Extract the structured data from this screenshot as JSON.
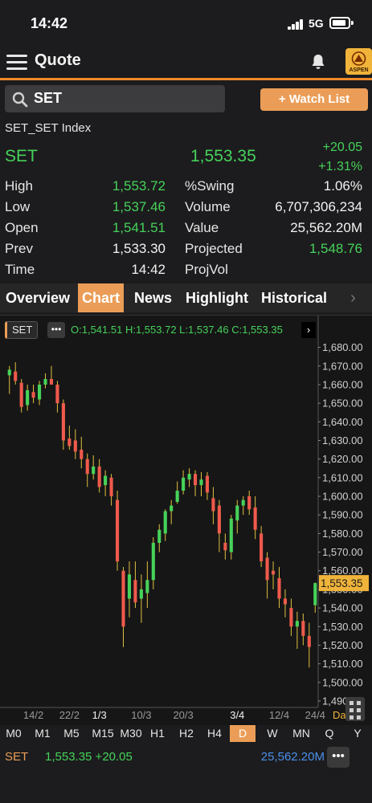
{
  "status_bar": {
    "time": "14:42",
    "network": "5G"
  },
  "header": {
    "title": "Quote",
    "logo_text": "ASPEN"
  },
  "search": {
    "value": "SET"
  },
  "watch_button": "+ Watch List",
  "quote": {
    "index_name": "SET_SET Index",
    "symbol": "SET",
    "last": "1,553.35",
    "change": "+20.05",
    "change_pct": "+1.31%"
  },
  "stats": [
    {
      "label": "High",
      "value": "1,553.72",
      "color": "green",
      "label2": "%Swing",
      "value2": "1.06%",
      "color2": "white"
    },
    {
      "label": "Low",
      "value": "1,537.46",
      "color": "green",
      "label2": "Volume",
      "value2": "6,707,306,234",
      "color2": "white"
    },
    {
      "label": "Open",
      "value": "1,541.51",
      "color": "green",
      "label2": "Value",
      "value2": "25,562.20M",
      "color2": "white"
    },
    {
      "label": "Prev",
      "value": "1,533.30",
      "color": "white",
      "label2": "Projected",
      "value2": "1,548.76",
      "color2": "green"
    },
    {
      "label": "Time",
      "value": "14:42",
      "color": "white",
      "label2": "ProjVol",
      "value2": "",
      "color2": "white"
    }
  ],
  "tabs": [
    "Overview",
    "Chart",
    "News",
    "Highlight",
    "Historical"
  ],
  "active_tab": "Chart",
  "chart_header": {
    "symbol": "SET",
    "ohlc": "O:1,541.51 H:1,553.72 L:1,537.46 C:1,553.35"
  },
  "chart_data": {
    "type": "candlestick",
    "ylim": [
      1490,
      1685
    ],
    "y_ticks": [
      "1,680.00",
      "1,670.00",
      "1,660.00",
      "1,650.00",
      "1,640.00",
      "1,630.00",
      "1,620.00",
      "1,610.00",
      "1,600.00",
      "1,590.00",
      "1,580.00",
      "1,570.00",
      "1,560.00",
      "1,550.00",
      "1,540.00",
      "1,530.00",
      "1,520.00",
      "1,510.00",
      "1,500.00",
      "1,490.00"
    ],
    "y_tick_values": [
      1680,
      1670,
      1660,
      1650,
      1640,
      1630,
      1620,
      1610,
      1600,
      1590,
      1580,
      1570,
      1560,
      1550,
      1540,
      1530,
      1520,
      1510,
      1500,
      1490
    ],
    "last_label": "1,553.35",
    "last_value": 1553.35,
    "x_labels": [
      {
        "text": "14/2",
        "i": 4,
        "color": "#999999"
      },
      {
        "text": "22/2",
        "i": 10,
        "color": "#999999"
      },
      {
        "text": "1/3",
        "i": 15,
        "color": "#f2f2f2"
      },
      {
        "text": "10/3",
        "i": 22,
        "color": "#999999"
      },
      {
        "text": "20/3",
        "i": 29,
        "color": "#999999"
      },
      {
        "text": "3/4",
        "i": 38,
        "color": "#f2f2f2"
      },
      {
        "text": "12/4",
        "i": 45,
        "color": "#999999"
      },
      {
        "text": "24/4",
        "i": 51,
        "color": "#999999"
      }
    ],
    "period_label": "Day",
    "up_color": "#46d25a",
    "down_color": "#ef5a4c",
    "candles": [
      [
        1665,
        1670,
        1655,
        1668
      ],
      [
        1667,
        1672,
        1660,
        1662
      ],
      [
        1661,
        1663,
        1645,
        1648
      ],
      [
        1649,
        1660,
        1646,
        1657
      ],
      [
        1656,
        1660,
        1650,
        1653
      ],
      [
        1652,
        1662,
        1649,
        1660
      ],
      [
        1660,
        1666,
        1658,
        1663
      ],
      [
        1663,
        1670,
        1660,
        1660
      ],
      [
        1660,
        1662,
        1645,
        1650
      ],
      [
        1650,
        1652,
        1625,
        1630
      ],
      [
        1631,
        1638,
        1625,
        1627
      ],
      [
        1630,
        1636,
        1620,
        1624
      ],
      [
        1625,
        1632,
        1615,
        1620
      ],
      [
        1620,
        1623,
        1605,
        1612
      ],
      [
        1612,
        1622,
        1609,
        1616
      ],
      [
        1616,
        1620,
        1602,
        1605
      ],
      [
        1606,
        1614,
        1600,
        1611
      ],
      [
        1610,
        1612,
        1595,
        1600
      ],
      [
        1598,
        1603,
        1560,
        1565
      ],
      [
        1560,
        1562,
        1519,
        1530
      ],
      [
        1545,
        1565,
        1535,
        1558
      ],
      [
        1555,
        1565,
        1540,
        1543
      ],
      [
        1545,
        1558,
        1532,
        1550
      ],
      [
        1548,
        1565,
        1540,
        1555
      ],
      [
        1555,
        1578,
        1550,
        1575
      ],
      [
        1575,
        1585,
        1570,
        1582
      ],
      [
        1580,
        1593,
        1576,
        1592
      ],
      [
        1592,
        1598,
        1585,
        1595
      ],
      [
        1597,
        1608,
        1596,
        1603
      ],
      [
        1603,
        1614,
        1601,
        1610
      ],
      [
        1609,
        1615,
        1605,
        1612
      ],
      [
        1612,
        1614,
        1600,
        1606
      ],
      [
        1606,
        1613,
        1600,
        1609
      ],
      [
        1611,
        1613,
        1598,
        1602
      ],
      [
        1599,
        1605,
        1585,
        1592
      ],
      [
        1595,
        1598,
        1570,
        1580
      ],
      [
        1575,
        1580,
        1566,
        1571
      ],
      [
        1570,
        1590,
        1566,
        1588
      ],
      [
        1587,
        1598,
        1580,
        1595
      ],
      [
        1595,
        1600,
        1590,
        1598
      ],
      [
        1600,
        1603,
        1590,
        1593
      ],
      [
        1594,
        1600,
        1577,
        1582
      ],
      [
        1580,
        1584,
        1562,
        1565
      ],
      [
        1567,
        1570,
        1545,
        1555
      ],
      [
        1560,
        1565,
        1550,
        1558
      ],
      [
        1556,
        1562,
        1540,
        1545
      ],
      [
        1545,
        1550,
        1535,
        1542
      ],
      [
        1540,
        1545,
        1525,
        1530
      ],
      [
        1530,
        1538,
        1518,
        1533
      ],
      [
        1533,
        1537,
        1520,
        1525
      ],
      [
        1525,
        1532,
        1508,
        1519
      ],
      [
        1541.51,
        1553.72,
        1537.46,
        1553.35
      ]
    ]
  },
  "timeframes": [
    "M0",
    "M1",
    "M5",
    "M15",
    "M30",
    "H1",
    "H2",
    "H4",
    "D",
    "W",
    "MN",
    "Q",
    "Y"
  ],
  "active_timeframe": "D",
  "footer": {
    "symbol": "SET",
    "last": "1,553.35 +20.05",
    "value": "25,562.20M",
    "more": "•••"
  },
  "colors": {
    "accent": "#eb9d57",
    "green": "#46d25a",
    "red": "#ef5a4c",
    "blue": "#4a8fe8"
  }
}
